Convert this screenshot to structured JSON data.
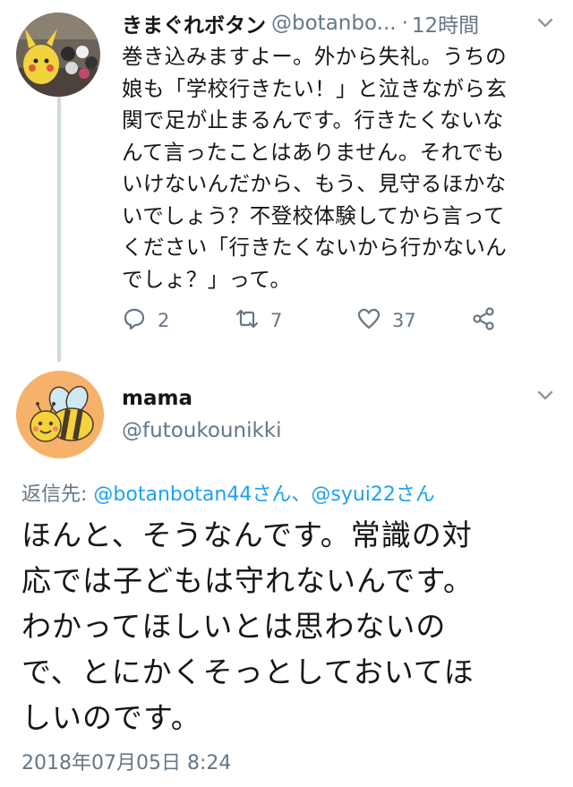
{
  "first_tweet": {
    "display_name": "きまぐれボタン",
    "handle": "@botanbo...",
    "separator": "·",
    "time": "12時間",
    "text": "巻き込みますよー。外から失礼。うちの\n娘も「学校行きたい！」と泣きながら玄\n関で足が止まるんです。行きたくないな\nんて言ったことはありません。それでも\nいけないんだから、もう、見守るほかな\nいでしょう？不登校体験してから言って\nください「行きたくないから行かないん\nでしょ？」って。",
    "actions": {
      "reply_count": "2",
      "retweet_count": "7",
      "like_count": "37"
    },
    "icons": {
      "reply": "reply-icon",
      "retweet": "retweet-icon",
      "like": "heart-icon",
      "share": "share-icon",
      "menu": "chevron-down-icon"
    }
  },
  "reply_tweet": {
    "display_name": "mama",
    "handle": "@futoukounikki",
    "reply_prefix": "返信先: ",
    "mention_1": "@botanbotan44さん",
    "mention_separator": "、",
    "mention_2": "@syui22さん",
    "text": "ほんと、そうなんです。常識の対\n応では子どもは守れないんです。\nわかってほしいとは思わないの\nで、とにかくそっとしておいてほ\nしいのです。",
    "timestamp": "2018年07月05日 8:24",
    "icons": {
      "menu": "chevron-down-icon"
    }
  },
  "colors": {
    "text": "#14171a",
    "secondary": "#657786",
    "link": "#1da1f2",
    "thread_line": "#cfd9de",
    "bee_background": "#f6b26b"
  }
}
